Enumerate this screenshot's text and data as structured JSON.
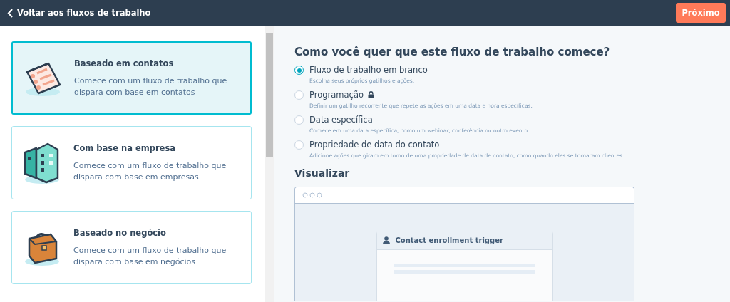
{
  "header": {
    "back_link": "Voltar aos fluxos de trabalho",
    "next_button": "Próximo"
  },
  "templates": [
    {
      "kind": "contact",
      "title": "Baseado em contatos",
      "description": "Comece com um fluxo de trabalho que dispara com base em contatos",
      "selected": true
    },
    {
      "kind": "company",
      "title": "Com base na empresa",
      "description": "Comece com um fluxo de trabalho que dispara com base em empresas",
      "selected": false
    },
    {
      "kind": "deal",
      "title": "Baseado no negócio",
      "description": "Comece com um fluxo de trabalho que dispara com base em negócios",
      "selected": false
    }
  ],
  "question": "Como você quer que este fluxo de trabalho comece?",
  "options": [
    {
      "label": "Fluxo de trabalho em branco",
      "hint": "Escolha seus próprios gatilhos e ações.",
      "selected": true,
      "locked": false
    },
    {
      "label": "Programação",
      "hint": "Definir um gatilho recorrente que repete as ações em uma data e hora específicas.",
      "selected": false,
      "locked": true
    },
    {
      "label": "Data específica",
      "hint": "Comece em uma data específica, como um webinar, conferência ou outro evento.",
      "selected": false,
      "locked": false
    },
    {
      "label": "Propriedade de data do contato",
      "hint": "Adicione ações que giram em torno de uma propriedade de data de contato, como quando eles se tornaram clientes.",
      "selected": false,
      "locked": false
    }
  ],
  "preview": {
    "title": "Visualizar",
    "trigger_title": "Contact enrollment trigger"
  }
}
